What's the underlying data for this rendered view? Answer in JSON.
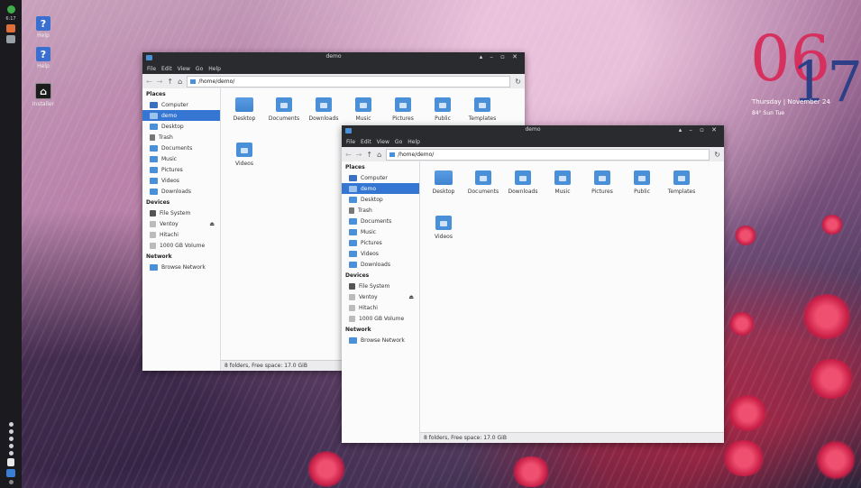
{
  "desktop": {
    "icons": [
      {
        "label": "Help",
        "icon": "help-icon"
      },
      {
        "label": "Help",
        "icon": "help-icon"
      },
      {
        "label": "Installer",
        "icon": "installer-icon"
      }
    ],
    "clock": {
      "hour": "06",
      "minute": "17",
      "date_line": "Thursday | November 24",
      "weather_line": "84° Sun Tue"
    }
  },
  "panel": {
    "time": "6:17",
    "colors": {
      "bg": "#1a1a1f"
    }
  },
  "window_back": {
    "title": "demo",
    "menu": [
      "File",
      "Edit",
      "View",
      "Go",
      "Help"
    ],
    "path": "/home/demo/",
    "sidebar": {
      "places_header": "Places",
      "places": [
        "Computer",
        "demo",
        "Desktop",
        "Trash",
        "Documents",
        "Music",
        "Pictures",
        "Videos",
        "Downloads"
      ],
      "devices_header": "Devices",
      "devices": [
        "File System",
        "Ventoy",
        "Hitachi",
        "1000 GB Volume"
      ],
      "network_header": "Network",
      "network": [
        "Browse Network"
      ]
    },
    "files": [
      "Desktop",
      "Documents",
      "Downloads",
      "Music",
      "Pictures",
      "Public",
      "Templates",
      "Videos"
    ],
    "status": "8 folders, Free space: 17.0 GiB"
  },
  "window_front": {
    "title": "demo",
    "menu": [
      "File",
      "Edit",
      "View",
      "Go",
      "Help"
    ],
    "path": "/home/demo/",
    "sidebar": {
      "places_header": "Places",
      "places": [
        "Computer",
        "demo",
        "Desktop",
        "Trash",
        "Documents",
        "Music",
        "Pictures",
        "Videos",
        "Downloads"
      ],
      "devices_header": "Devices",
      "devices": [
        "File System",
        "Ventoy",
        "Hitachi",
        "1000 GB Volume"
      ],
      "network_header": "Network",
      "network": [
        "Browse Network"
      ]
    },
    "files": [
      "Desktop",
      "Documents",
      "Downloads",
      "Music",
      "Pictures",
      "Public",
      "Templates",
      "Videos"
    ],
    "status": "8 folders, Free space: 17.0 GiB"
  },
  "colors": {
    "accent": "#3576d2",
    "folder": "#4a90d9",
    "titlebar": "#2a2b2f",
    "clock_hour": "#d6305e",
    "clock_minute": "#2d3f86"
  }
}
